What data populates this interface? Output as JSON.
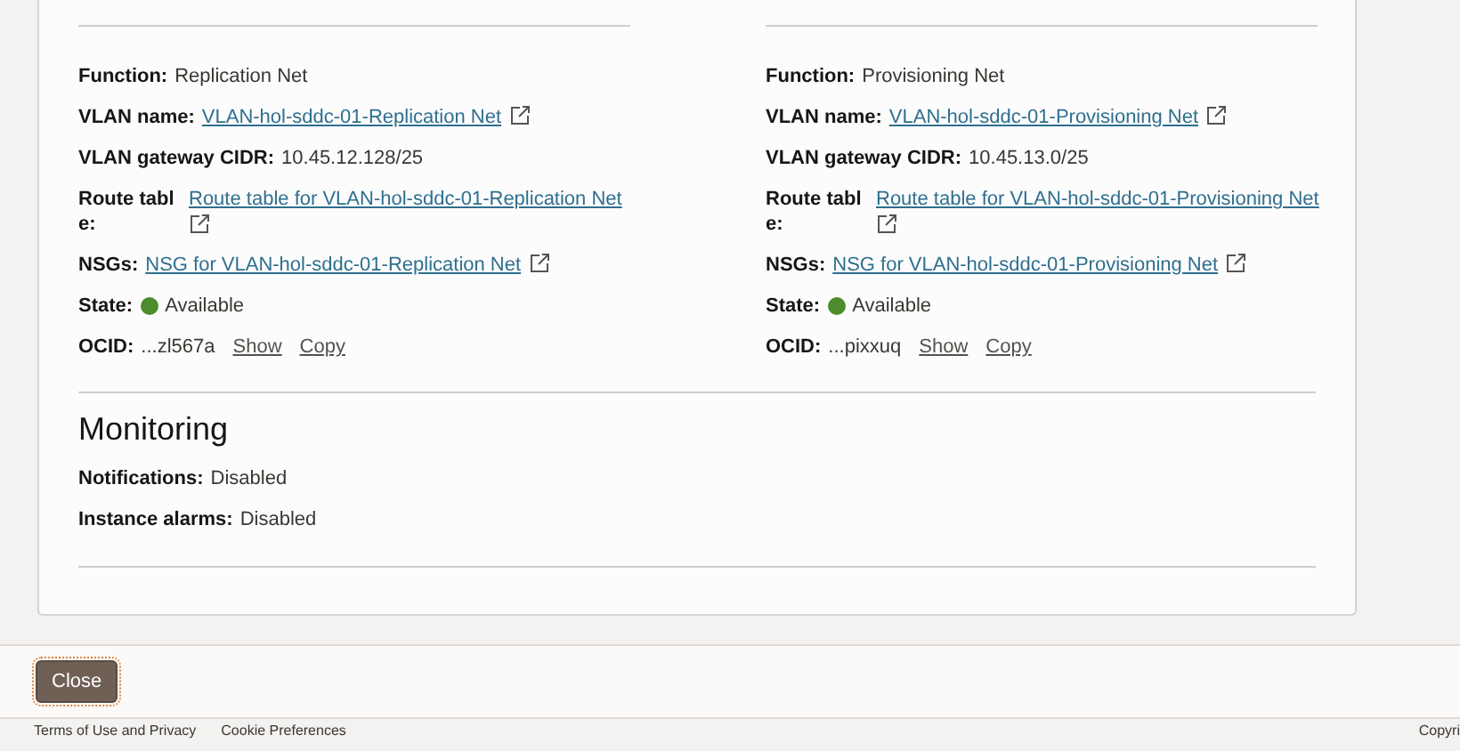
{
  "networks": [
    {
      "function_label": "Function:",
      "function": "Replication Net",
      "vlan_label": "VLAN name:",
      "vlan": "VLAN-hol-sddc-01-Replication Net",
      "cidr_label": "VLAN gateway CIDR:",
      "cidr": "10.45.12.128/25",
      "route_label": "Route tabl e:",
      "route": "Route table for VLAN-hol-sddc-01-Replication Net",
      "nsg_label": "NSGs:",
      "nsg": "NSG for VLAN-hol-sddc-01-Replication Net",
      "state_label": "State:",
      "state": "Available",
      "color": "#4c8c2b",
      "ocid_label": "OCID:",
      "ocid": "...zl567a",
      "show": "Show",
      "copy": "Copy"
    },
    {
      "function_label": "Function:",
      "function": "Provisioning Net",
      "vlan_label": "VLAN name:",
      "vlan": "VLAN-hol-sddc-01-Provisioning Net",
      "cidr_label": "VLAN gateway CIDR:",
      "cidr": "10.45.13.0/25",
      "route_label": "Route tabl e:",
      "route": "Route table for VLAN-hol-sddc-01-Provisioning Net",
      "nsg_label": "NSGs:",
      "nsg": "NSG for VLAN-hol-sddc-01-Provisioning Net",
      "state_label": "State:",
      "state": "Available",
      "color": "#4c8c2b",
      "ocid_label": "OCID:",
      "ocid": "...pixxuq",
      "show": "Show",
      "copy": "Copy"
    }
  ],
  "monitoring": {
    "title": "Monitoring",
    "fields": [
      {
        "label": "Notifications:",
        "value": "Disabled"
      },
      {
        "label": "Instance alarms:",
        "value": "Disabled"
      }
    ]
  },
  "close_button": "Close",
  "footer": {
    "links": [
      "Terms of Use and Privacy",
      "Cookie Preferences"
    ],
    "copyright": "Copyri"
  }
}
